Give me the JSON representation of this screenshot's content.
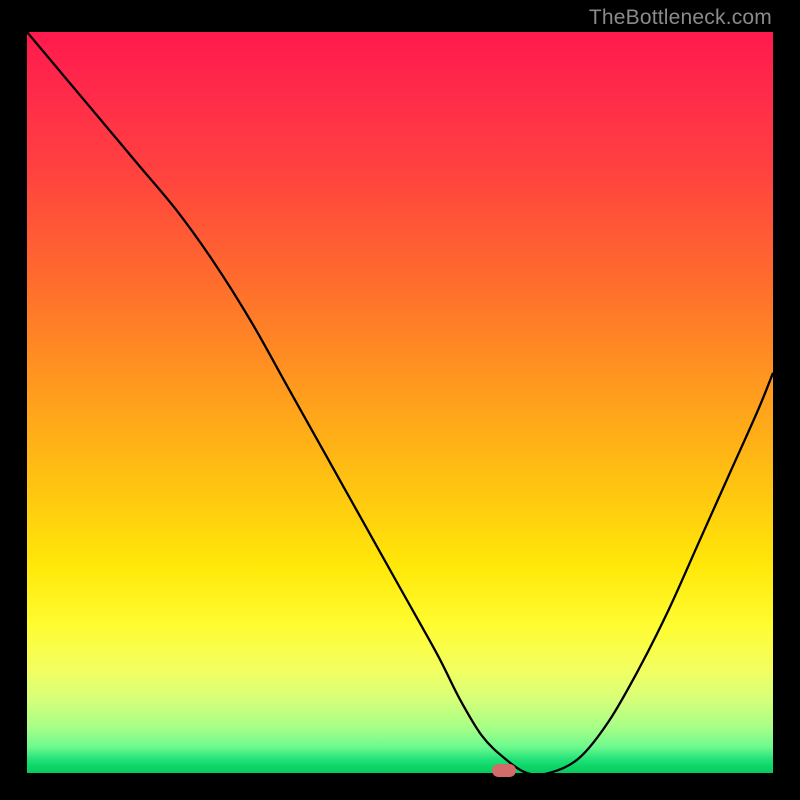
{
  "watermark": "TheBottleneck.com",
  "chart_data": {
    "type": "line",
    "title": "",
    "xlabel": "",
    "ylabel": "",
    "xlim": [
      0,
      100
    ],
    "ylim": [
      0,
      100
    ],
    "grid": false,
    "series": [
      {
        "name": "curve",
        "x": [
          0,
          5,
          10,
          15,
          20,
          25,
          30,
          35,
          40,
          45,
          50,
          55,
          58,
          61,
          64,
          67,
          70,
          74,
          78,
          82,
          86,
          90,
          94,
          98,
          100
        ],
        "y": [
          100,
          94,
          88,
          82,
          76,
          69,
          61,
          52,
          43,
          34,
          25,
          16,
          10,
          5,
          2,
          0,
          0,
          2,
          7,
          14,
          22,
          31,
          40,
          49,
          54
        ]
      }
    ],
    "marker": {
      "x": 64,
      "y": 0
    },
    "background_gradient": [
      "#ff1a4d",
      "#ff4040",
      "#ff9a1e",
      "#ffe809",
      "#fffc30",
      "#a4ff88",
      "#28e57a",
      "#07c95f"
    ]
  }
}
